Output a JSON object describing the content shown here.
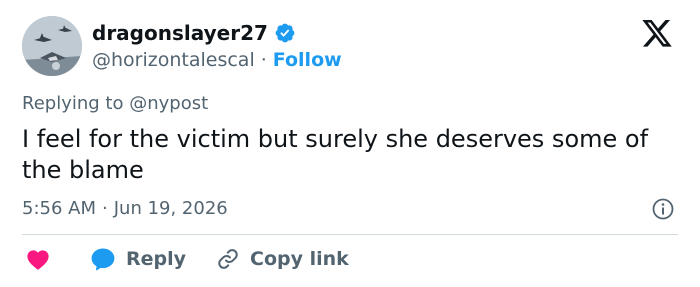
{
  "user": {
    "display_name": "dragonslayer27",
    "handle": "@horizontalescal",
    "separator": "·",
    "follow_label": "Follow"
  },
  "reply": {
    "prefix": "Replying to",
    "mention": "@nypost"
  },
  "tweet": {
    "text": "I feel for the victim but surely she deserves some of the blame",
    "time": "5:56 AM",
    "separator": "·",
    "date": "Jun 19, 2026"
  },
  "actions": {
    "reply_label": "Reply",
    "copy_link_label": "Copy link"
  },
  "colors": {
    "accent": "#1d9bf0",
    "heart": "#f91880",
    "text": "#0f1419",
    "secondary": "#536471"
  },
  "icons": [
    "verified-badge-icon",
    "x-logo-icon",
    "info-icon",
    "heart-icon",
    "reply-bubble-icon",
    "link-icon"
  ]
}
